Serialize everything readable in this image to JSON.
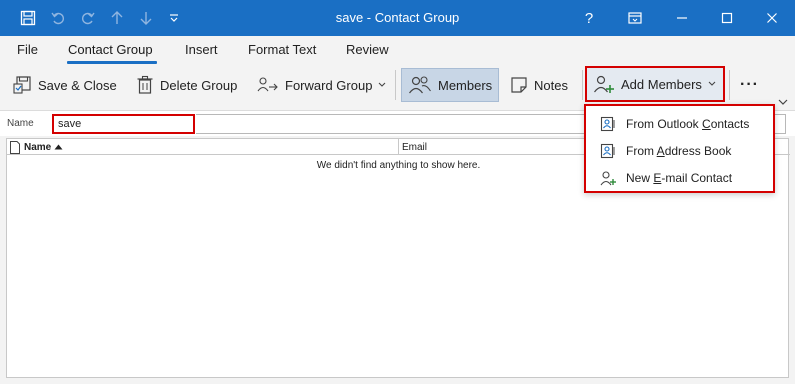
{
  "window": {
    "title": "save  -  Contact Group",
    "title_bg": "#1a6fc4",
    "help": "?"
  },
  "tabs": [
    "File",
    "Contact Group",
    "Insert",
    "Format Text",
    "Review"
  ],
  "ribbon": {
    "save_close": "Save & Close",
    "delete_group": "Delete Group",
    "forward_group": "Forward Group",
    "members": "Members",
    "notes": "Notes",
    "add_members": "Add Members",
    "more": "···"
  },
  "name": {
    "label": "Name",
    "value": "save"
  },
  "table": {
    "col_name": "Name",
    "col_email": "Email",
    "empty_message": "We didn't find anything to show here."
  },
  "add_members_menu": {
    "items": [
      {
        "pre": "From Outlook ",
        "ul": "C",
        "post": "ontacts"
      },
      {
        "pre": "From ",
        "ul": "A",
        "post": "ddress Book"
      },
      {
        "pre": "New ",
        "ul": "E",
        "post": "-mail Contact"
      }
    ]
  },
  "highlight_color": "#d40000"
}
